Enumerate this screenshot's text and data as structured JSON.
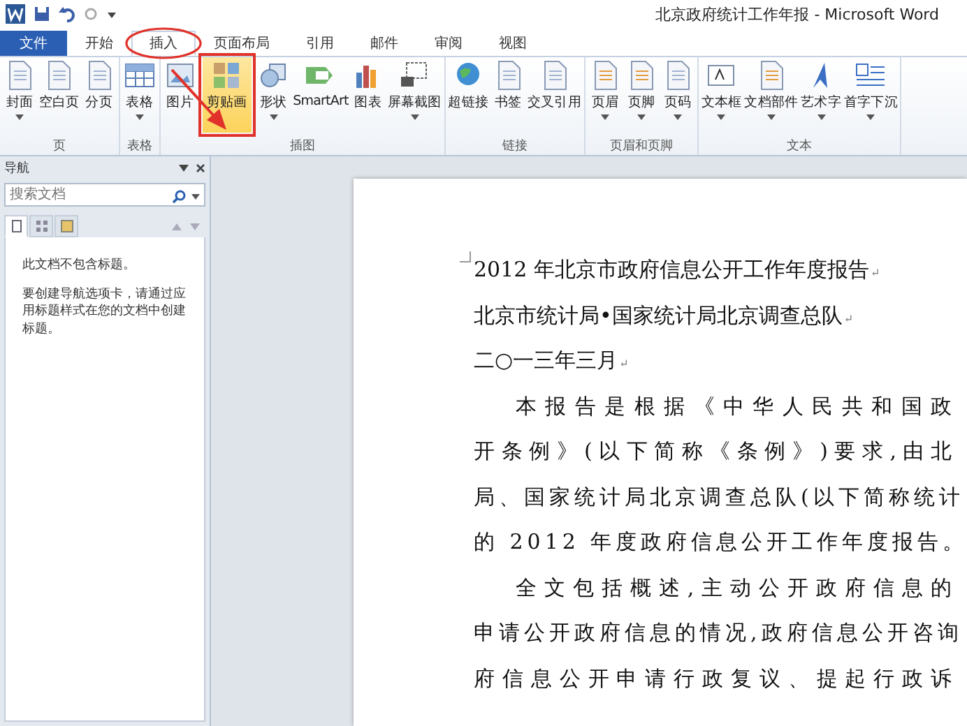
{
  "window": {
    "title": "北京政府统计工作年报 - Microsoft Word"
  },
  "file_tab": {
    "label": "文件"
  },
  "tabs": [
    {
      "label": "开始",
      "selected": false
    },
    {
      "label": "插入",
      "selected": true,
      "highlighted": true
    },
    {
      "label": "页面布局",
      "selected": false
    },
    {
      "label": "引用",
      "selected": false
    },
    {
      "label": "邮件",
      "selected": false
    },
    {
      "label": "审阅",
      "selected": false
    },
    {
      "label": "视图",
      "selected": false
    }
  ],
  "ribbon_groups": [
    {
      "label": "页",
      "buttons": [
        {
          "label": "封面",
          "dropdown": true,
          "selected": false
        },
        {
          "label": "空白页",
          "dropdown": false,
          "selected": false
        },
        {
          "label": "分页",
          "dropdown": false,
          "selected": false
        }
      ]
    },
    {
      "label": "表格",
      "buttons": [
        {
          "label": "表格",
          "dropdown": true,
          "selected": false
        }
      ]
    },
    {
      "label": "插图",
      "buttons": [
        {
          "label": "图片",
          "dropdown": false,
          "selected": false
        },
        {
          "label": "剪贴画",
          "dropdown": false,
          "selected": true
        },
        {
          "label": "形状",
          "dropdown": true,
          "selected": false
        },
        {
          "label": "SmartArt",
          "dropdown": false,
          "selected": false
        },
        {
          "label": "图表",
          "dropdown": false,
          "selected": false
        },
        {
          "label": "屏幕截图",
          "dropdown": true,
          "selected": false
        }
      ]
    },
    {
      "label": "链接",
      "buttons": [
        {
          "label": "超链接",
          "dropdown": false,
          "selected": false
        },
        {
          "label": "书签",
          "dropdown": false,
          "selected": false
        },
        {
          "label": "交叉引用",
          "dropdown": false,
          "selected": false
        }
      ]
    },
    {
      "label": "页眉和页脚",
      "buttons": [
        {
          "label": "页眉",
          "dropdown": true,
          "selected": false
        },
        {
          "label": "页脚",
          "dropdown": true,
          "selected": false
        },
        {
          "label": "页码",
          "dropdown": true,
          "selected": false
        }
      ]
    },
    {
      "label": "文本",
      "buttons": [
        {
          "label": "文本框",
          "dropdown": true,
          "selected": false
        },
        {
          "label": "文档部件",
          "dropdown": true,
          "selected": false
        },
        {
          "label": "艺术字",
          "dropdown": true,
          "selected": false
        },
        {
          "label": "首字下沉",
          "dropdown": true,
          "selected": false
        }
      ]
    }
  ],
  "navigation": {
    "title": "导航",
    "search": {
      "placeholder": "搜索文档"
    },
    "view_tabs": [
      {
        "selected": true
      },
      {
        "selected": false
      },
      {
        "selected": false
      }
    ],
    "messages": [
      "此文档不包含标题。",
      "要创建导航选项卡，请通过应用标题样式在您的文档中创建标题。"
    ]
  },
  "document": {
    "headings": [
      {
        "text": "2012 年北京市政府信息公开工作年度报告",
        "end_mark": "↵"
      },
      {
        "text": "北京市统计局•国家统计局北京调查总队",
        "end_mark": "↵"
      },
      {
        "text": "二○一三年三月",
        "end_mark": "↵"
      }
    ],
    "paragraphs": [
      {
        "lines": [
          "本报告是根据《中华人民共和国政",
          "开条例》(以下简称《条例》)要求,由北",
          "局、国家统计局北京调查总队(以下简称统计",
          "的 2012 年度政府信息公开工作年度报告。"
        ]
      },
      {
        "lines": [
          "全文包括概述,主动公开政府信息的",
          "申请公开政府信息的情况,政府信息公开咨询",
          "府信息公开申请行政复议、提起行政诉"
        ]
      }
    ]
  }
}
